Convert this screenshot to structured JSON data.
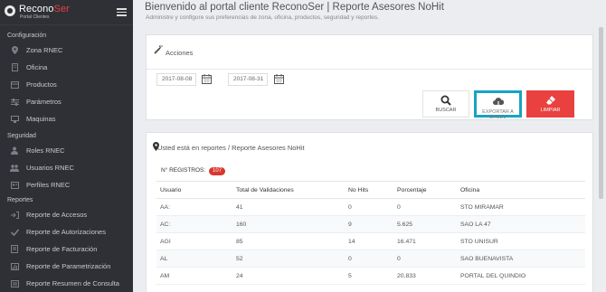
{
  "brand": {
    "name_main": "Recono",
    "name_accent": "Ser",
    "subtitle": "Portal Clientes"
  },
  "header": {
    "title": "Bienvenido al portal cliente ReconoSer | Reporte Asesores NoHit",
    "subtitle": "Administre y configure sus preferencias de zona, oficina, productos, seguridad y reportes."
  },
  "sidebar": {
    "sections": {
      "configuracion": "Configuración",
      "seguridad": "Seguridad",
      "reportes": "Reportes"
    },
    "config_items": [
      {
        "label": "Zona RNEC",
        "icon": "map-marker-icon"
      },
      {
        "label": "Oficina",
        "icon": "building-icon"
      },
      {
        "label": "Productos",
        "icon": "box-icon"
      },
      {
        "label": "Parámetros",
        "icon": "sliders-icon"
      },
      {
        "label": "Maquinas",
        "icon": "desktop-icon"
      }
    ],
    "security_items": [
      {
        "label": "Roles RNEC",
        "icon": "user-icon"
      },
      {
        "label": "Usuarios RNEC",
        "icon": "users-icon"
      },
      {
        "label": "Perfiles RNEC",
        "icon": "id-card-icon"
      }
    ],
    "report_items": [
      {
        "label": "Reporte de Accesos",
        "icon": "sign-in-icon"
      },
      {
        "label": "Reporte de Autorizaciones",
        "icon": "check-icon"
      },
      {
        "label": "Reporte de Facturación",
        "icon": "invoice-icon"
      },
      {
        "label": "Reporte de Parametrización",
        "icon": "bar-chart-icon"
      },
      {
        "label": "Reporte Resumen de Consulta",
        "icon": "list-icon"
      }
    ]
  },
  "actions": {
    "title": "Acciones",
    "date_from": "2017-08-08",
    "date_to": "2017-08-31",
    "buscar_label": "BUSCAR",
    "excel_label": "EXPORTAR A EXCEL",
    "limpiar_label": "LIMPIAR"
  },
  "report": {
    "breadcrumb": "Usted está en reportes / Reporte Asesores NoHit",
    "registros_label": "N° REGISTROS:",
    "registros_count": "107",
    "columns": [
      "Usuario",
      "Total de Validaciones",
      "No Hits",
      "Porcentaje",
      "Oficina"
    ],
    "rows": [
      [
        "AA:",
        "41",
        "0",
        "0",
        "STO MIRAMAR"
      ],
      [
        "AC:",
        "160",
        "9",
        "5.625",
        "SAO LA 47"
      ],
      [
        "AGI",
        "85",
        "14",
        "16.471",
        "STO UNISUR"
      ],
      [
        "AL",
        "52",
        "0",
        "0",
        "SAO BUENAVISTA"
      ],
      [
        "AM",
        "24",
        "5",
        "20.833",
        "PORTAL DEL QUINDIO"
      ]
    ]
  },
  "colors": {
    "sidebar_bg": "#2f3035",
    "accent_red": "#e8413f",
    "excel_border": "#18a3c4"
  }
}
